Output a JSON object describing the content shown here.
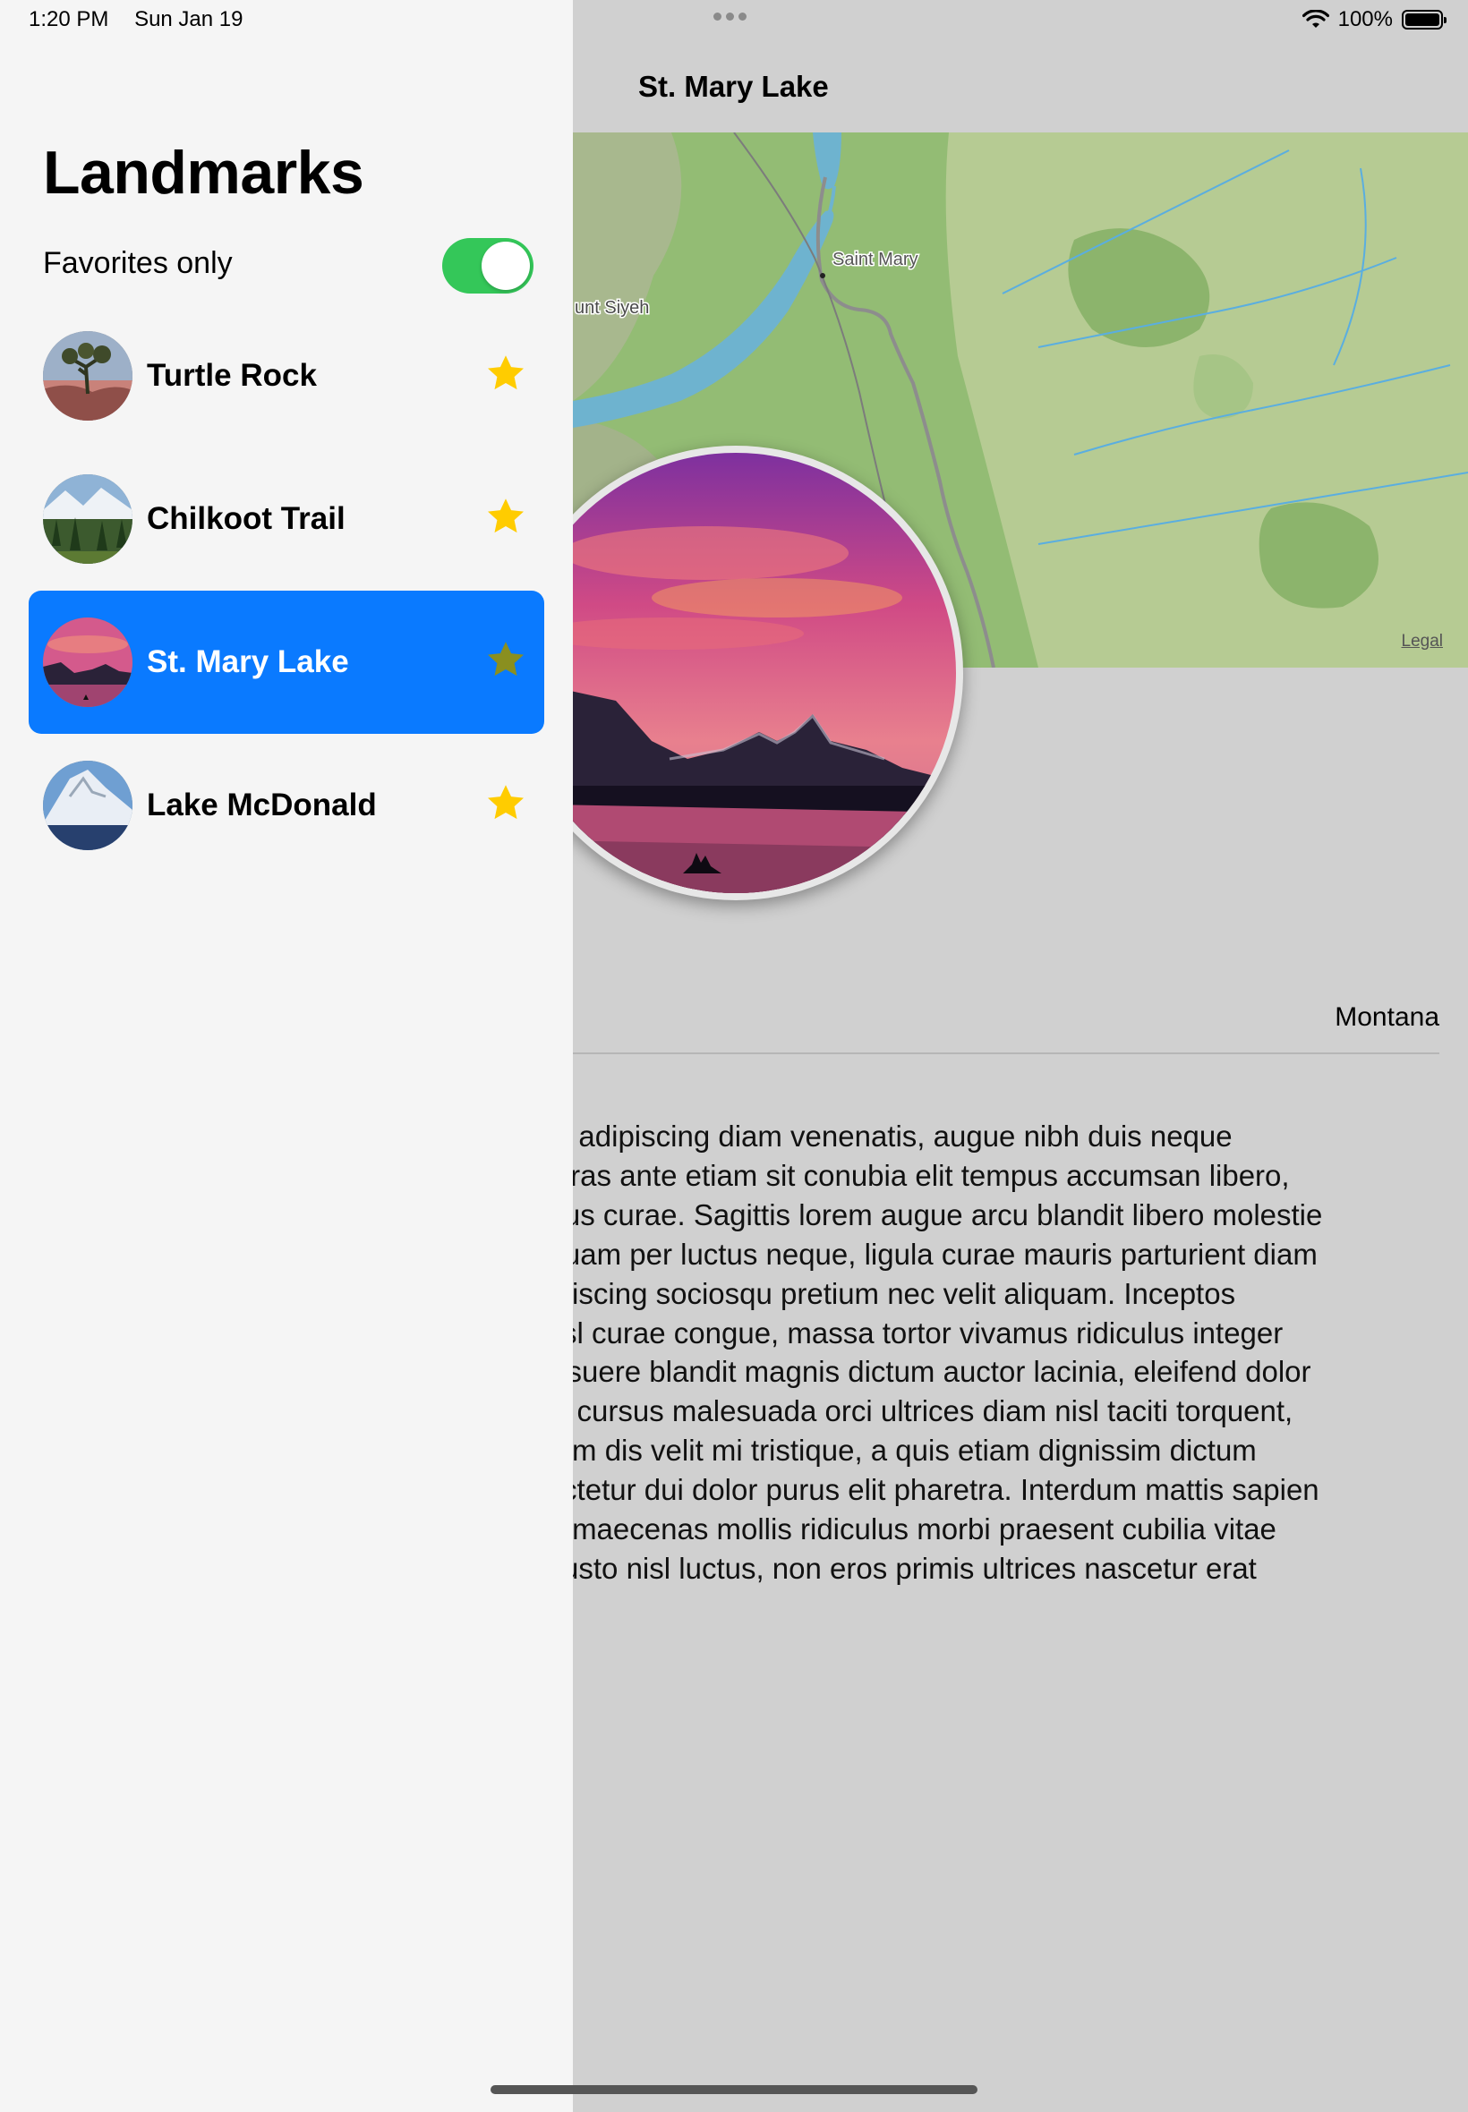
{
  "status_bar": {
    "time": "1:20 PM",
    "date": "Sun Jan 19",
    "battery": "100%"
  },
  "sidebar": {
    "title": "Landmarks",
    "favorites_label": "Favorites only",
    "favorites_on": true,
    "items": [
      {
        "name": "Turtle Rock",
        "favorite": true,
        "icon": "star-icon"
      },
      {
        "name": "Chilkoot Trail",
        "favorite": true,
        "icon": "star-icon"
      },
      {
        "name": "St. Mary Lake",
        "favorite": true,
        "icon": "star-icon",
        "selected": true
      },
      {
        "name": "Lake McDonald",
        "favorite": true,
        "icon": "star-icon"
      }
    ]
  },
  "detail": {
    "nav_title": "St. Mary Lake",
    "map": {
      "labels": [
        "Saint Mary",
        "unt Siyeh"
      ],
      "legal": "Legal"
    },
    "state": "Montana",
    "description_lines": [
      "aliquet adipiscing diam venenatis, augue nibh duis neque",
      "mus, cras ante etiam sit conubia elit tempus accumsan libero,",
      "enatibus curae. Sagittis lorem augue arcu blandit libero molestie",
      "s ad quam per luctus neque, ligula curae mauris parturient diam",
      "rit adipiscing sociosqu pretium nec velit aliquam. Inceptos",
      "nec nisl curae congue, massa tortor vivamus ridiculus integer",
      "r et posuere blandit magnis dictum auctor lacinia, eleifend dolor",
      "ucibus cursus malesuada orci ultrices diam nisl taciti torquent,",
      "imentum dis velit mi tristique, a quis etiam dignissim dictum",
      "consectetur dui dolor purus elit pharetra. Interdum mattis sapien",
      "n hac, maecenas mollis ridiculus morbi praesent cubilia vitae",
      "auris justo nisl luctus, non eros primis ultrices nascetur erat"
    ]
  },
  "colors": {
    "accent": "#0A7AFF",
    "toggle_on": "#34C759",
    "star": "#FFCC00",
    "star_selected": "#8A8F1F"
  }
}
